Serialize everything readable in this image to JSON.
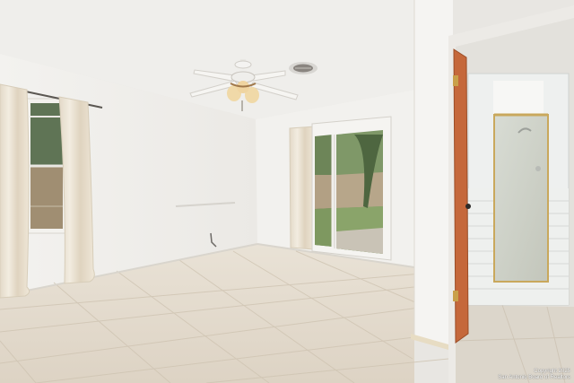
{
  "photo": {
    "copyright_line1": "Copyright 2025",
    "copyright_line2": "San Antonio Board of Realtors"
  },
  "colors": {
    "ceiling": "#f1f0ed",
    "wall": "#f4f3f0",
    "floor": "#e6dccd",
    "curtain": "#ece4d6",
    "door_wood": "#c8693a"
  },
  "objects": [
    "ceiling-fan",
    "window-with-curtains",
    "sliding-glass-door",
    "bathroom-doorway",
    "shower-stall",
    "tile-floor"
  ]
}
